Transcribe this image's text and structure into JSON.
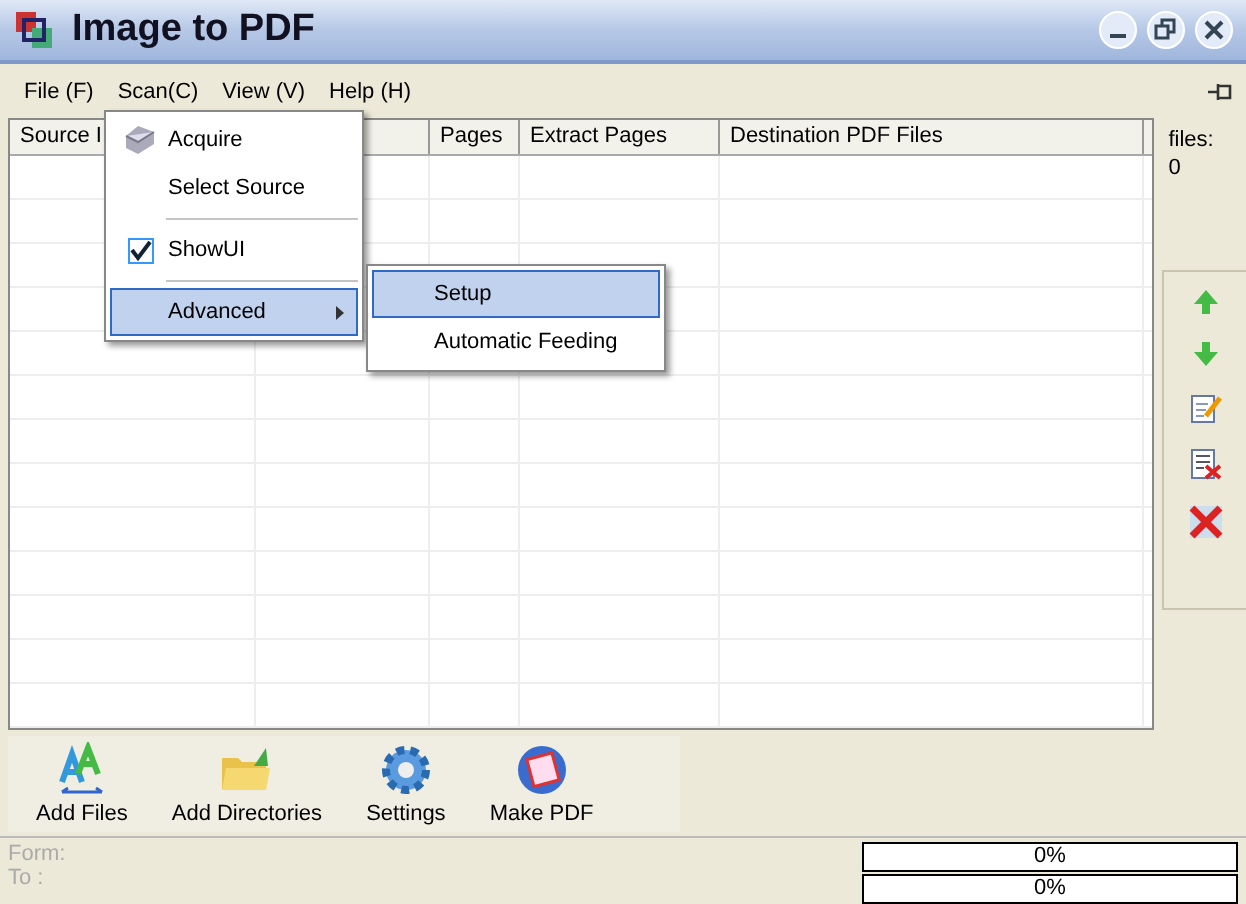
{
  "window": {
    "title": "Image to PDF"
  },
  "menu_bar": [
    {
      "label": "File (F)"
    },
    {
      "label": "Scan(C)"
    },
    {
      "label": "View (V)"
    },
    {
      "label": "Help (H)"
    }
  ],
  "scan_menu": [
    {
      "kind": "item",
      "label": "Acquire",
      "checked": false,
      "selected": false,
      "submenu": false
    },
    {
      "kind": "item",
      "label": "Select Source",
      "checked": false,
      "selected": false,
      "submenu": false
    },
    {
      "kind": "separator"
    },
    {
      "kind": "item",
      "label": "ShowUI",
      "checked": true,
      "selected": false,
      "submenu": false
    },
    {
      "kind": "separator"
    },
    {
      "kind": "item",
      "label": "Advanced",
      "checked": false,
      "selected": true,
      "submenu": true
    }
  ],
  "submenu": [
    {
      "label": "Setup",
      "selected": true
    },
    {
      "label": "Automatic Feeding",
      "selected": false
    }
  ],
  "table": {
    "columns": [
      "Source I",
      "Pages",
      "Extract Pages",
      "Destination PDF Files"
    ]
  },
  "files": {
    "label": "files:",
    "count": "0"
  },
  "toolbar": [
    {
      "label": "Add Files"
    },
    {
      "label": "Add Directories"
    },
    {
      "label": "Settings"
    },
    {
      "label": "Make PDF"
    }
  ],
  "status": {
    "from_label": "Form:",
    "to_label": "To :",
    "progress": [
      {
        "level": 0,
        "reading": "0%"
      },
      {
        "level": 0,
        "reading": "0%"
      }
    ]
  }
}
